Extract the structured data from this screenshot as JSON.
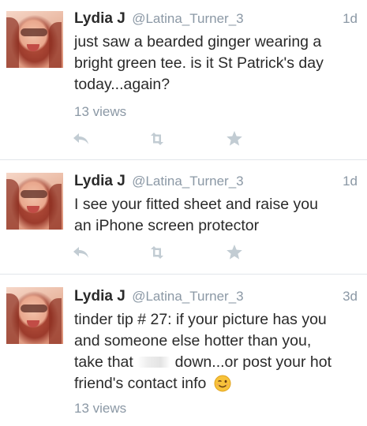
{
  "tweets": [
    {
      "author_name": "Lydia J",
      "author_handle": "@Latina_Turner_3",
      "time": "1d",
      "lines": [
        "just saw a bearded ginger wearing a",
        "bright green tee. is it St Patrick's day",
        "today...again?"
      ],
      "views": "13 views",
      "actions": [
        "reply-icon",
        "retweet-icon",
        "favorite-icon"
      ]
    },
    {
      "author_name": "Lydia J",
      "author_handle": "@Latina_Turner_3",
      "time": "1d",
      "lines": [
        "I see your fitted sheet and raise you",
        "an iPhone screen protector"
      ],
      "actions": [
        "reply-icon",
        "retweet-icon",
        "favorite-icon"
      ]
    },
    {
      "author_name": "Lydia J",
      "author_handle": "@Latina_Turner_3",
      "time": "3d",
      "lines": [
        "tinder tip # 27:  if your picture has you",
        "and someone else hotter than you,",
        "take that",
        "down...or post your hot",
        "friend's contact info"
      ],
      "emoji": "winking-face-emoji",
      "views": "13 views"
    }
  ],
  "colors": {
    "text": "#2a2a2a",
    "muted": "#8b98a5",
    "action_icons": "#c2ccd3",
    "divider": "#e1e6ea"
  }
}
